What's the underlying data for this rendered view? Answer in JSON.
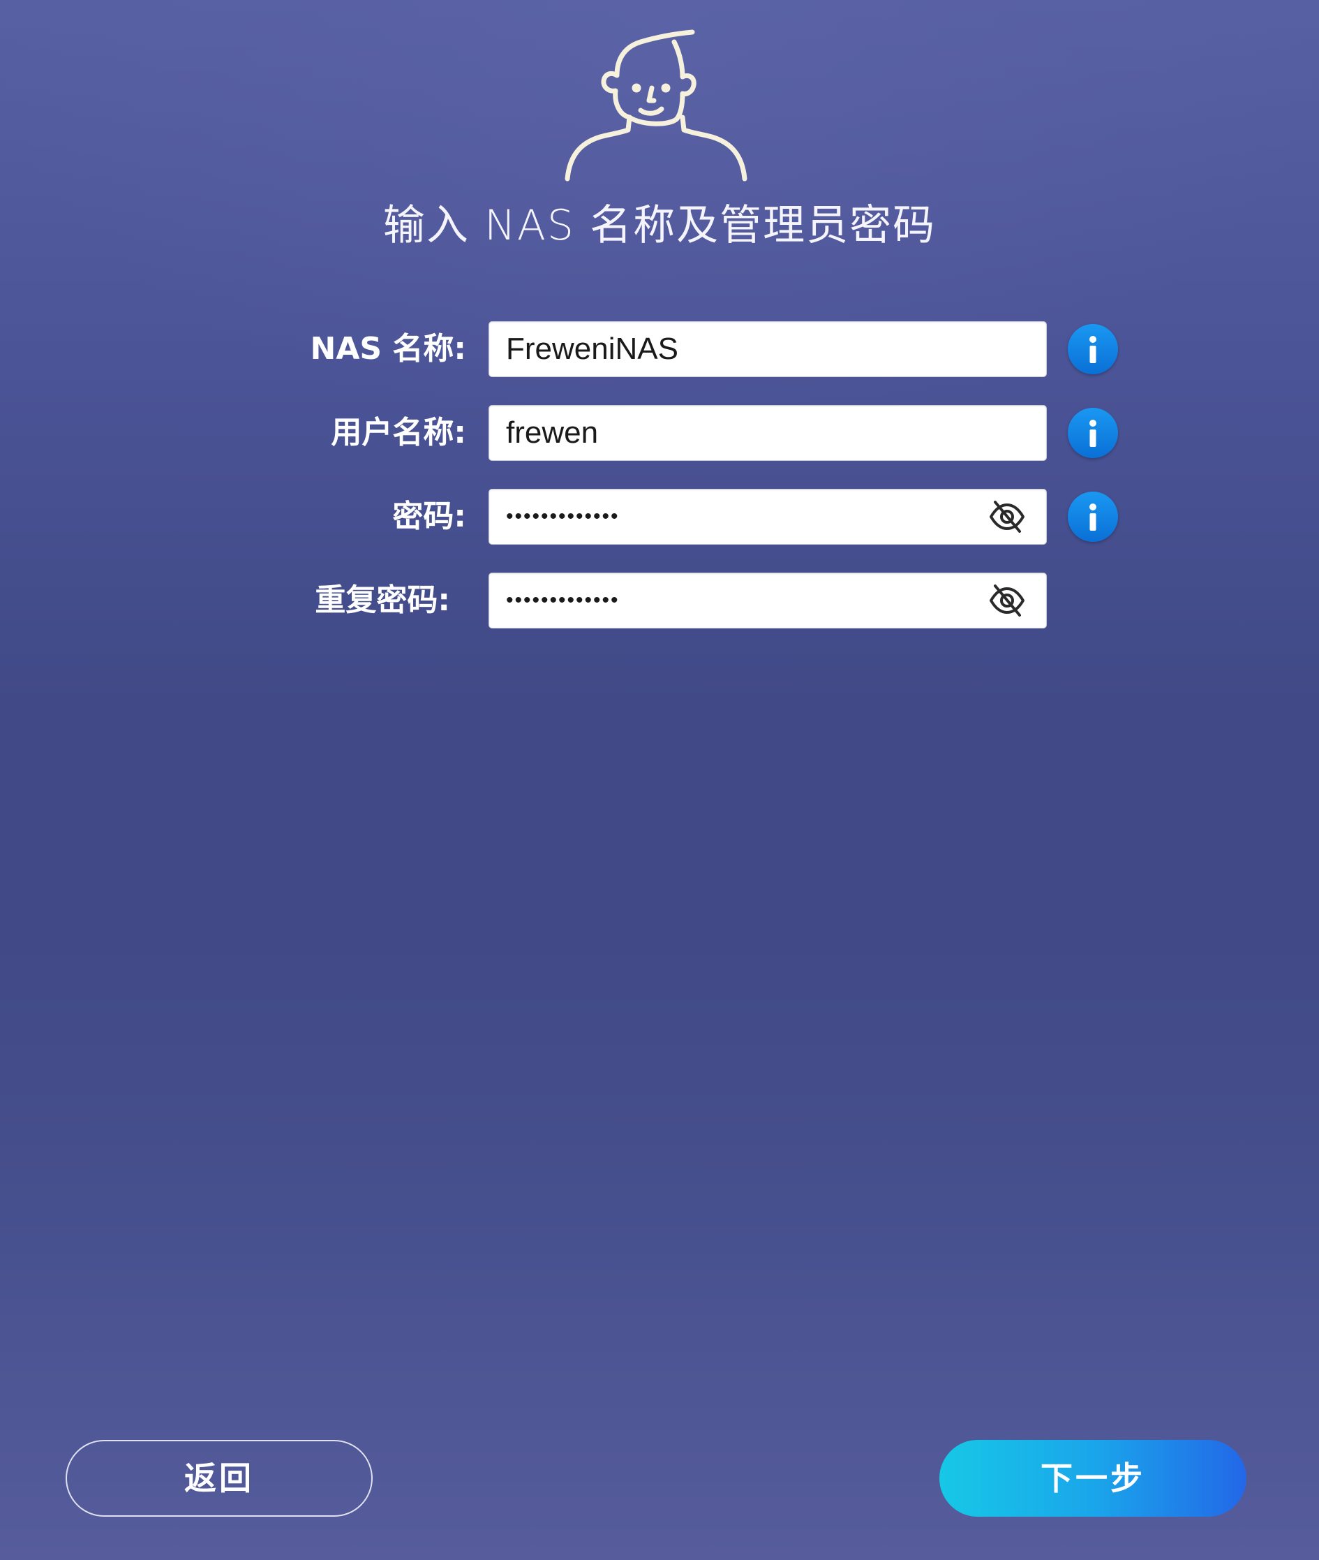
{
  "header": {
    "title": "输入 NAS 名称及管理员密码",
    "avatar_icon": "user-avatar-icon"
  },
  "form": {
    "nas_name": {
      "label": "NAS 名称:",
      "value": "FreweniNAS",
      "info_icon": "info-icon"
    },
    "username": {
      "label": "用户名称:",
      "value": "frewen",
      "info_icon": "info-icon"
    },
    "password": {
      "label": "密码:",
      "value": "•••••••••••••",
      "toggle_icon": "eye-slash-icon",
      "info_icon": "info-icon"
    },
    "confirm_password": {
      "label": "重复密码:",
      "value": "•••••••••••••",
      "toggle_icon": "eye-slash-icon"
    }
  },
  "footer": {
    "back_label": "返回",
    "next_label": "下一步"
  },
  "colors": {
    "accent_info": "#0a84ff",
    "next_gradient_start": "#17c8e6",
    "next_gradient_end": "#2367e8",
    "avatar_stroke": "#f5f1dc"
  }
}
